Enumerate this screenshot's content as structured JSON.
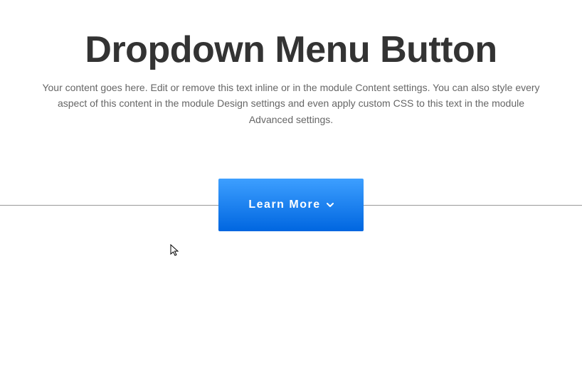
{
  "header": {
    "title": "Dropdown Menu Button",
    "description": "Your content goes here. Edit or remove this text inline or in the module Content settings. You can also style every aspect of this content in the module Design settings and even apply custom CSS to this text in the module Advanced settings."
  },
  "button": {
    "label": "Learn More",
    "icon": "chevron-down-icon"
  }
}
